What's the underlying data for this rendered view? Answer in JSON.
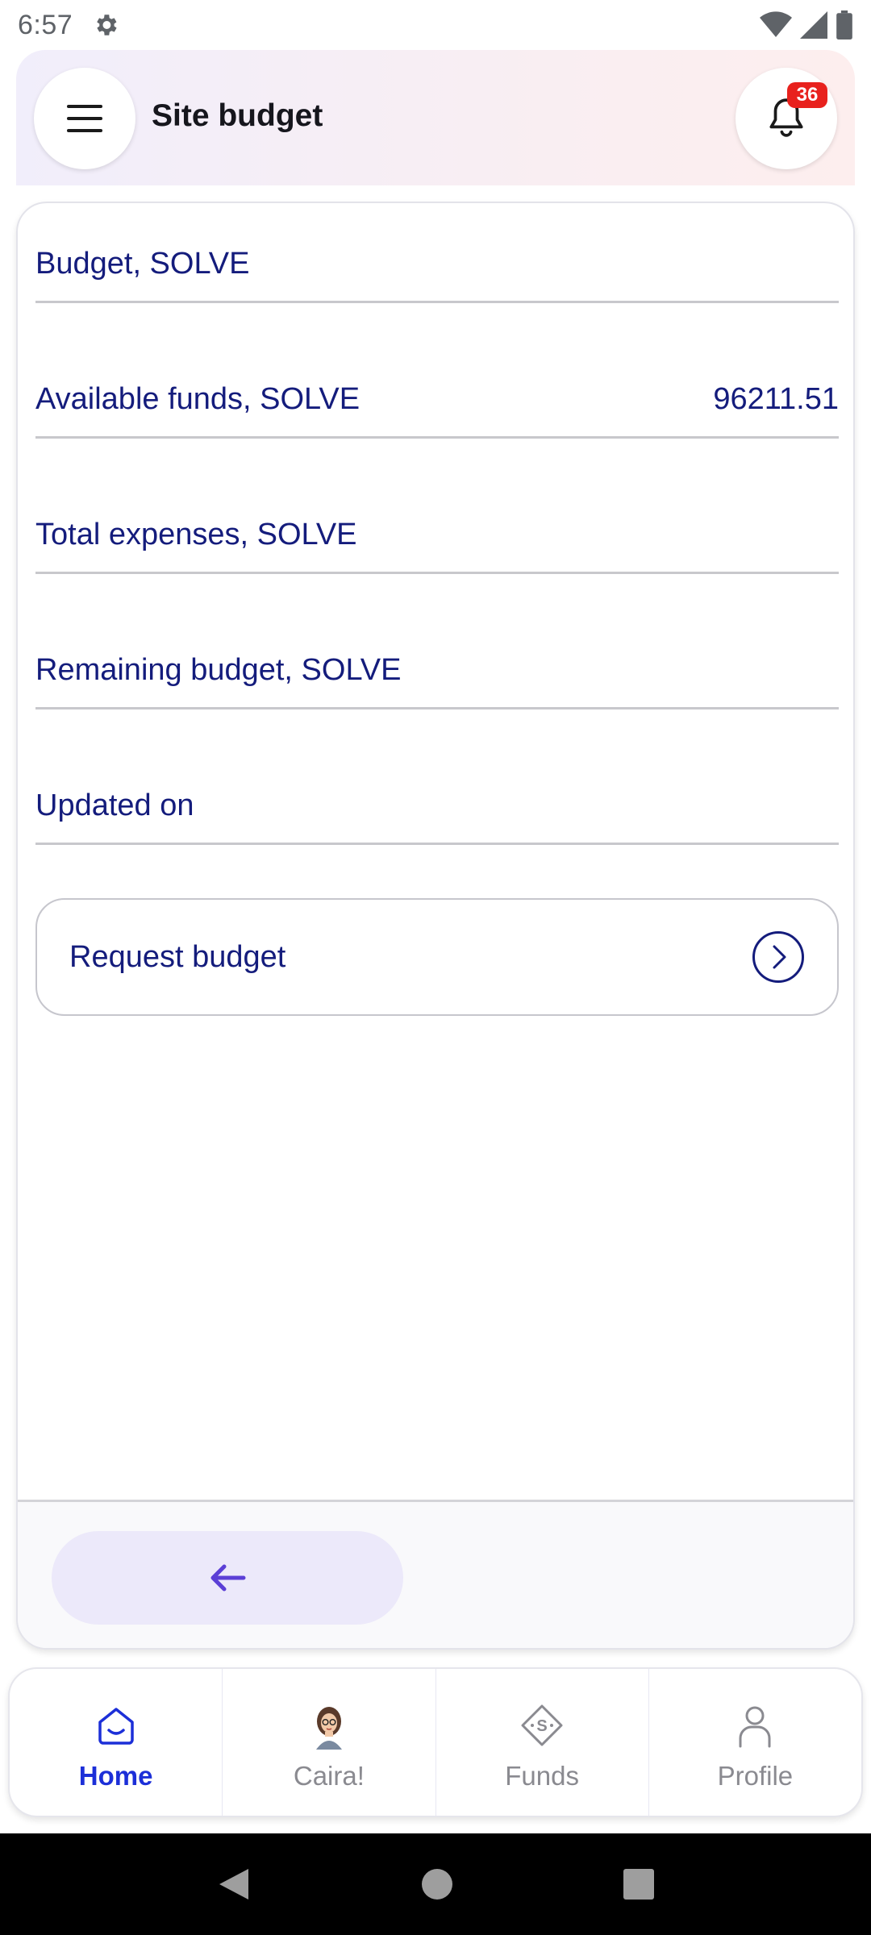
{
  "status_bar": {
    "time": "6:57"
  },
  "header": {
    "title": "Site budget",
    "notification_count": "36"
  },
  "fields": [
    {
      "label": "Budget, SOLVE",
      "value": ""
    },
    {
      "label": "Available funds, SOLVE",
      "value": "96211.51"
    },
    {
      "label": "Total expenses, SOLVE",
      "value": ""
    },
    {
      "label": "Remaining budget, SOLVE",
      "value": ""
    },
    {
      "label": "Updated on",
      "value": ""
    }
  ],
  "request_button": {
    "label": "Request budget"
  },
  "bottom_nav": {
    "items": [
      {
        "label": "Home",
        "icon": "home-icon",
        "active": true
      },
      {
        "label": "Caira!",
        "icon": "assistant-avatar-icon",
        "active": false
      },
      {
        "label": "Funds",
        "icon": "funds-icon",
        "active": false
      },
      {
        "label": "Profile",
        "icon": "profile-icon",
        "active": false
      }
    ]
  },
  "colors": {
    "text_primary": "#141c7c",
    "active_nav": "#1c2fd8",
    "back_button_bg": "#ece9fa",
    "badge": "#e8211d"
  }
}
